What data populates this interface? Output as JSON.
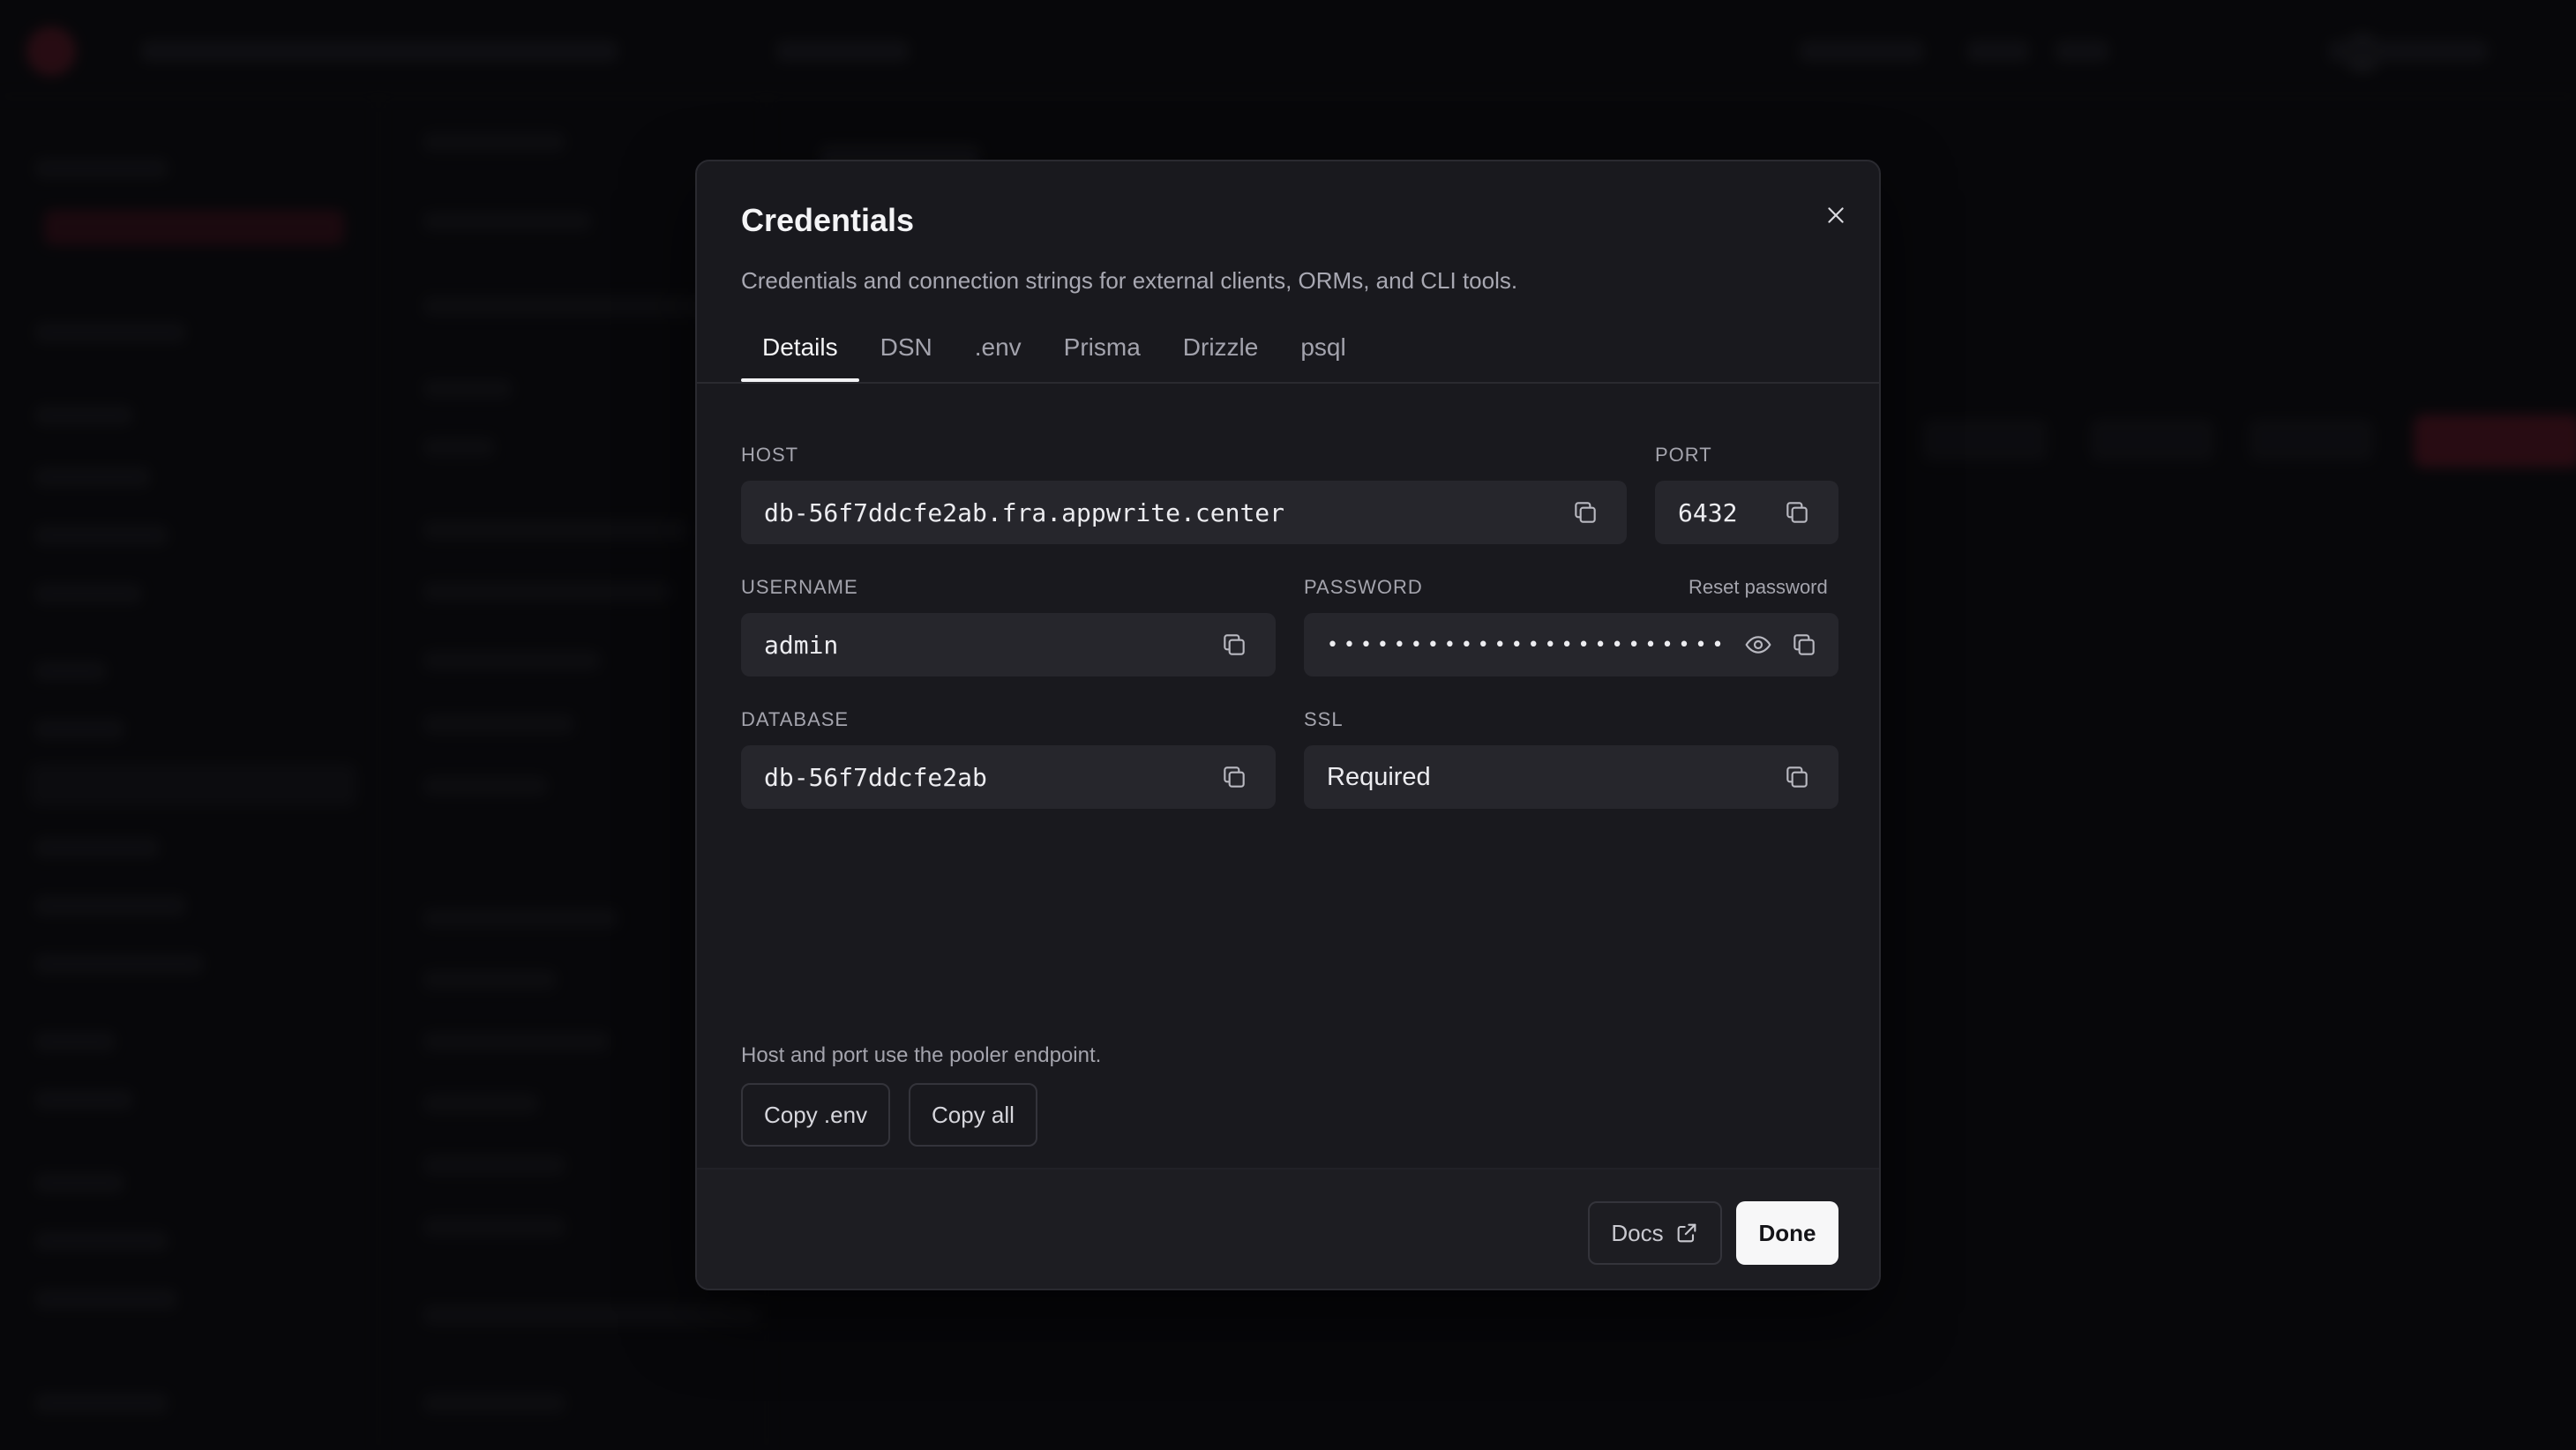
{
  "dialog": {
    "title": "Credentials",
    "subtitle": "Credentials and connection strings for external clients, ORMs, and CLI tools.",
    "tabs": [
      {
        "label": "Details",
        "active": true
      },
      {
        "label": "DSN",
        "active": false
      },
      {
        "label": ".env",
        "active": false
      },
      {
        "label": "Prisma",
        "active": false
      },
      {
        "label": "Drizzle",
        "active": false
      },
      {
        "label": "psql",
        "active": false
      }
    ],
    "fields": {
      "host": {
        "label": "HOST",
        "value": "db-56f7ddcfe2ab.fra.appwrite.center"
      },
      "port": {
        "label": "PORT",
        "value": "6432"
      },
      "username": {
        "label": "USERNAME",
        "value": "admin"
      },
      "password": {
        "label": "PASSWORD",
        "value": "••••••••••••••••••••••••",
        "reset_label": "Reset password"
      },
      "database": {
        "label": "DATABASE",
        "value": "db-56f7ddcfe2ab"
      },
      "ssl": {
        "label": "SSL",
        "value": "Required"
      }
    },
    "hint": "Host and port use the pooler endpoint.",
    "actions": {
      "copy_env": "Copy .env",
      "copy_all": "Copy all"
    },
    "footer": {
      "docs": "Docs",
      "done": "Done"
    }
  },
  "icons": {
    "close": "close-icon",
    "copy": "copy-icon",
    "eye": "eye-icon",
    "external": "external-link-icon"
  },
  "colors": {
    "modal_bg": "#19191e",
    "field_bg": "#26262c",
    "accent_active_tab": "#f2f2f4",
    "primary_button": "#f7f7f8"
  }
}
